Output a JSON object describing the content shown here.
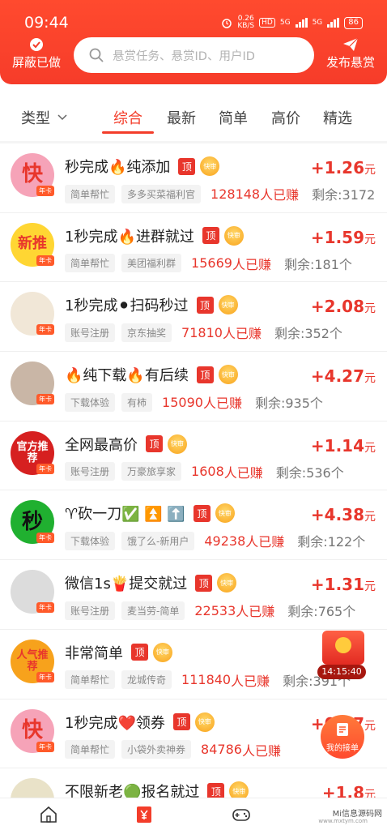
{
  "status_bar": {
    "time": "09:44",
    "speed_value": "0.26",
    "speed_unit": "KB/S",
    "hd": "HD",
    "sig1": "5G",
    "sig2": "5G",
    "battery": "86"
  },
  "header": {
    "block_label": "屏蔽已做",
    "search_placeholder": "悬赏任务、悬赏ID、用户ID",
    "publish_label": "发布悬赏"
  },
  "tabs": {
    "type_label": "类型",
    "items": [
      "综合",
      "最新",
      "简单",
      "高价",
      "精选"
    ],
    "active_index": 0
  },
  "labels": {
    "top": "顶",
    "fast": "快审",
    "earned_suffix": "人已赚",
    "remain_prefix": "剩余:",
    "unit": "元",
    "avatar_tag": "年卡"
  },
  "tasks": [
    {
      "title": "秒完成🔥纯添加",
      "reward": "+1.26",
      "category": "简单帮忙",
      "source": "多多买菜福利官",
      "earned": "128148",
      "remain": "3172",
      "avatar_text": "快",
      "avatar_color": "#f6a3b8",
      "avatar_fg": "#e8362c"
    },
    {
      "title": "1秒完成🔥进群就过",
      "reward": "+1.59",
      "category": "简单帮忙",
      "source": "美团福利群",
      "earned": "15669",
      "remain": "181个",
      "avatar_text": "新推",
      "avatar_color": "#ffd633",
      "avatar_fg": "#e8362c"
    },
    {
      "title": "1秒完成⚫扫码秒过",
      "reward": "+2.08",
      "category": "账号注册",
      "source": "京东抽奖",
      "earned": "71810",
      "remain": "352个",
      "avatar_text": "",
      "avatar_color": "#f1e7d7",
      "avatar_fg": "#222"
    },
    {
      "title": "🔥纯下载🔥有后续",
      "reward": "+4.27",
      "category": "下载体验",
      "source": "有柿",
      "earned": "15090",
      "remain": "935个",
      "avatar_text": "",
      "avatar_color": "#c9b6a6",
      "avatar_fg": "#222"
    },
    {
      "title": "全网最高价",
      "reward": "+1.14",
      "category": "账号注册",
      "source": "万豪旅享家",
      "earned": "1608",
      "remain": "536个",
      "avatar_text": "官方推荐",
      "avatar_color": "#d62020",
      "avatar_fg": "#fff"
    },
    {
      "title": "♈砍一刀✅ ⏫ ⬆️",
      "reward": "+4.38",
      "category": "下载体验",
      "source": "饿了么-新用户",
      "earned": "49238",
      "remain": "122个",
      "avatar_text": "秒",
      "avatar_color": "#20b030",
      "avatar_fg": "#111"
    },
    {
      "title": "微信1s🍟提交就过",
      "reward": "+1.31",
      "category": "账号注册",
      "source": "麦当劳-简单",
      "earned": "22533",
      "remain": "765个",
      "avatar_text": "",
      "avatar_color": "#dcdcdc",
      "avatar_fg": "#222"
    },
    {
      "title": "非常简单",
      "reward": "",
      "category": "简单帮忙",
      "source": "龙城传奇",
      "earned": "111840",
      "remain": "391个",
      "avatar_text": "人气推荐",
      "avatar_color": "#f7a21c",
      "avatar_fg": "#e8362c"
    },
    {
      "title": "1秒完成❤️领券",
      "reward": "+0.47",
      "category": "简单帮忙",
      "source": "小袋外卖神券",
      "earned": "84786",
      "remain": "",
      "avatar_text": "快",
      "avatar_color": "#f6a3b8",
      "avatar_fg": "#e8362c"
    },
    {
      "title": "不限新老🟢报名就过",
      "reward": "+1.8",
      "category": "",
      "source": "",
      "earned": "",
      "remain": "",
      "avatar_text": "",
      "avatar_color": "#e9e2c8",
      "avatar_fg": "#222"
    }
  ],
  "floating": {
    "timer": "14:15:40",
    "orders_label": "我的接单"
  },
  "bottom_nav": {
    "watermark": "Mi信息源码网",
    "watermark_sub": "www.mxtym.com"
  },
  "colors": {
    "brand_red": "#f33d2a",
    "reward_red": "#e8362c"
  }
}
